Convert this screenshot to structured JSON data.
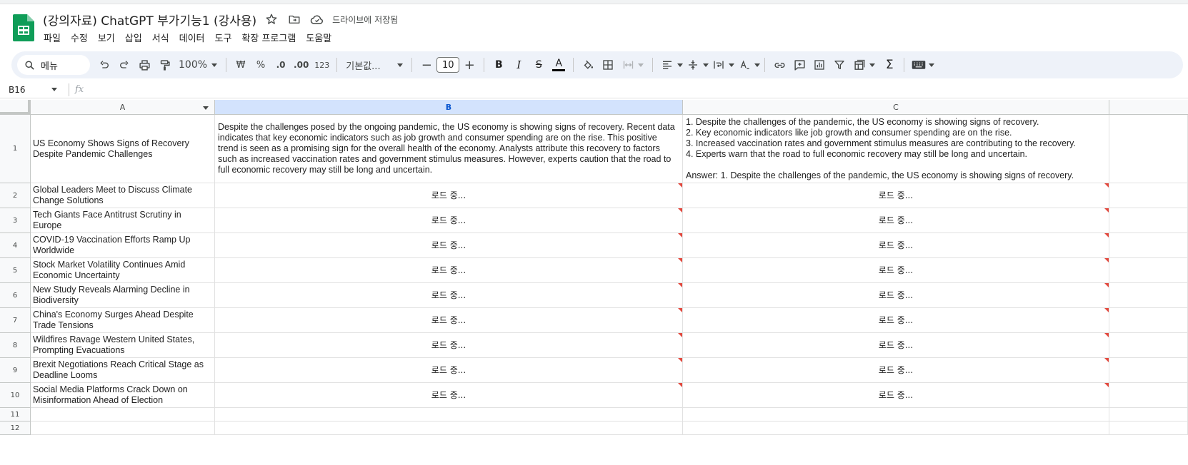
{
  "header": {
    "doc_title": "(강의자료) ChatGPT 부가기능1 (강사용)",
    "save_status": "드라이브에 저장됨",
    "menu": [
      "파일",
      "수정",
      "보기",
      "삽입",
      "서식",
      "데이터",
      "도구",
      "확장 프로그램",
      "도움말"
    ]
  },
  "toolbar": {
    "search_label": "메뉴",
    "zoom": "100%",
    "currency": "₩",
    "percent": "%",
    "dec_decrease": ".0",
    "dec_increase": ".00",
    "number_format": "123",
    "font": "기본값...",
    "font_size": "10",
    "minus": "−",
    "plus": "+",
    "bold": "B",
    "italic": "I",
    "strike": "S",
    "text_color": "A",
    "sum": "Σ",
    "colors": {
      "accent": "#0b57d0",
      "toolbar_bg": "#eef2f9",
      "sheets_green": "#0f9d58",
      "error_flag": "#e2483d"
    }
  },
  "formula_bar": {
    "cell_ref": "B16",
    "fx": "fx"
  },
  "grid": {
    "columns": [
      "A",
      "B",
      "C"
    ],
    "selected_column": "B",
    "row_numbers": [
      "1",
      "2",
      "3",
      "4",
      "5",
      "6",
      "7",
      "8",
      "9",
      "10",
      "11",
      "12"
    ],
    "rows": [
      {
        "a": "US Economy Shows Signs of Recovery Despite Pandemic Challenges",
        "b": "Despite the challenges posed by the ongoing pandemic, the US economy is showing signs of recovery. Recent data indicates that key economic indicators such as job growth and consumer spending are on the rise. This positive trend is seen as a promising sign for the overall health of the economy. Analysts attribute this recovery to factors such as increased vaccination rates and government stimulus measures. However, experts caution that the road to full economic recovery may still be long and uncertain.",
        "c": "1. Despite the challenges of the pandemic, the US economy is showing signs of recovery.\n2. Key economic indicators like job growth and consumer spending are on the rise.\n3. Increased vaccination rates and government stimulus measures are contributing to the recovery.\n4. Experts warn that the road to full economic recovery may still be long and uncertain.\n\nAnswer: 1. Despite the challenges of the pandemic, the US economy is showing signs of recovery."
      },
      {
        "a": "Global Leaders Meet to Discuss Climate Change Solutions",
        "b": "로드 중...",
        "c": "로드 중..."
      },
      {
        "a": "Tech Giants Face Antitrust Scrutiny in Europe",
        "b": "로드 중...",
        "c": "로드 중..."
      },
      {
        "a": "COVID-19 Vaccination Efforts Ramp Up Worldwide",
        "b": "로드 중...",
        "c": "로드 중..."
      },
      {
        "a": "Stock Market Volatility Continues Amid Economic Uncertainty",
        "b": "로드 중...",
        "c": "로드 중..."
      },
      {
        "a": "New Study Reveals Alarming Decline in Biodiversity",
        "b": "로드 중...",
        "c": "로드 중..."
      },
      {
        "a": "China's Economy Surges Ahead Despite Trade Tensions",
        "b": "로드 중...",
        "c": "로드 중..."
      },
      {
        "a": "Wildfires Ravage Western United States, Prompting Evacuations",
        "b": "로드 중...",
        "c": "로드 중..."
      },
      {
        "a": "Brexit Negotiations Reach Critical Stage as Deadline Looms",
        "b": "로드 중...",
        "c": "로드 중..."
      },
      {
        "a": "Social Media Platforms Crack Down on Misinformation Ahead of Election",
        "b": "로드 중...",
        "c": "로드 중..."
      },
      {
        "a": "",
        "b": "",
        "c": ""
      },
      {
        "a": "",
        "b": "",
        "c": ""
      }
    ]
  }
}
